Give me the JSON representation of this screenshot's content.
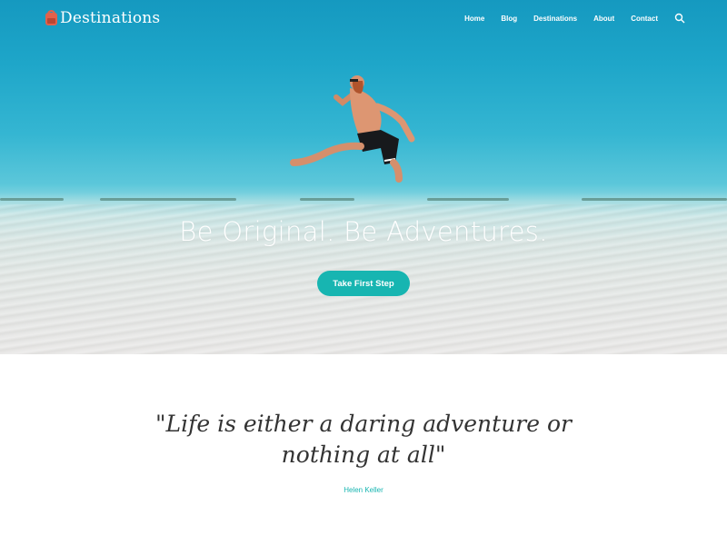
{
  "header": {
    "site_name": "Destinations",
    "nav": [
      {
        "label": "Home"
      },
      {
        "label": "Blog"
      },
      {
        "label": "Destinations"
      },
      {
        "label": "About"
      },
      {
        "label": "Contact"
      }
    ],
    "search_icon": "search-icon",
    "logo_icon": "backpack-icon"
  },
  "hero": {
    "headline": "Be Original. Be Adventures.",
    "cta_label": "Take First Step"
  },
  "quote": {
    "line1": "\"Life is either a daring adventure or",
    "line2": "nothing at all\"",
    "author": "Helen Keller"
  },
  "colors": {
    "accent": "#17b5b1",
    "sky": "#1599c0",
    "sand": "#e6e7e6"
  }
}
